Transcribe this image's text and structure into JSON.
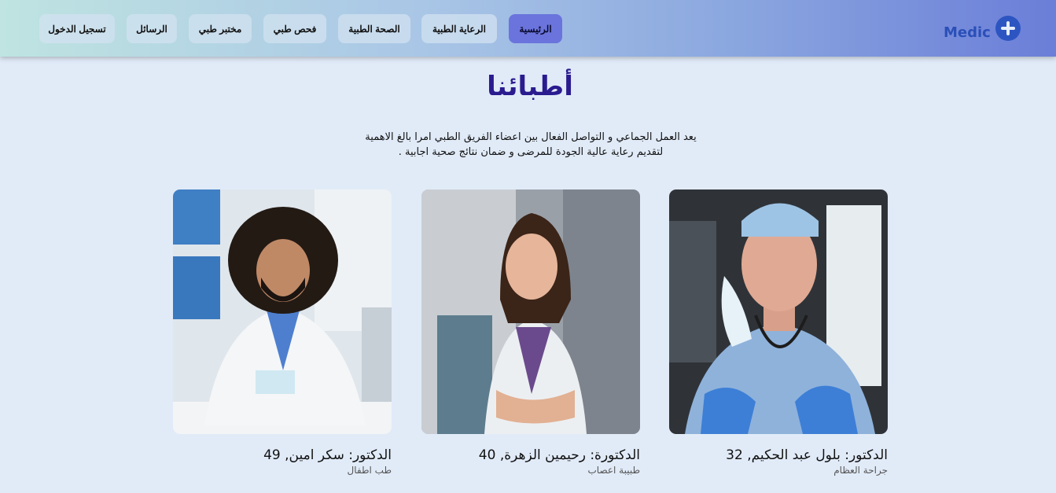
{
  "navbar": {
    "logo_text": "Medic",
    "items": [
      {
        "label": "تسجيل الدخول",
        "active": false
      },
      {
        "label": "الرسائل",
        "active": false
      },
      {
        "label": "مختبر طبي",
        "active": false
      },
      {
        "label": "فحص طبي",
        "active": false
      },
      {
        "label": "الصحة الطبية",
        "active": false
      },
      {
        "label": "الرعاية الطبية",
        "active": false
      },
      {
        "label": "الرئيسية",
        "active": true
      }
    ]
  },
  "page": {
    "title": "أطبائنا",
    "intro_line1": "يعد العمل الجماعي و التواصل الفعال بين اعضاء الفريق الطبي امرا بالغ الاهمية",
    "intro_line2": "لتقديم رعاية عالية الجودة للمرضى و ضمان نتائج صحية اجابية ."
  },
  "doctors": [
    {
      "name": "الدكتور: سكر امين, 49",
      "specialty": "طب اطفال"
    },
    {
      "name": "الدكتورة: رحيمين الزهرة, 40",
      "specialty": "طبيبة اعصاب"
    },
    {
      "name": "الدكتور: بلول عبد الحكيم, 32",
      "specialty": "جراحة العظام"
    }
  ],
  "colors": {
    "accent": "#6a74dc",
    "title": "#2a1b8f",
    "logo": "#2d55c2",
    "background": "#e1ebf8"
  },
  "icons": {
    "logo": "plus-circle-icon"
  }
}
